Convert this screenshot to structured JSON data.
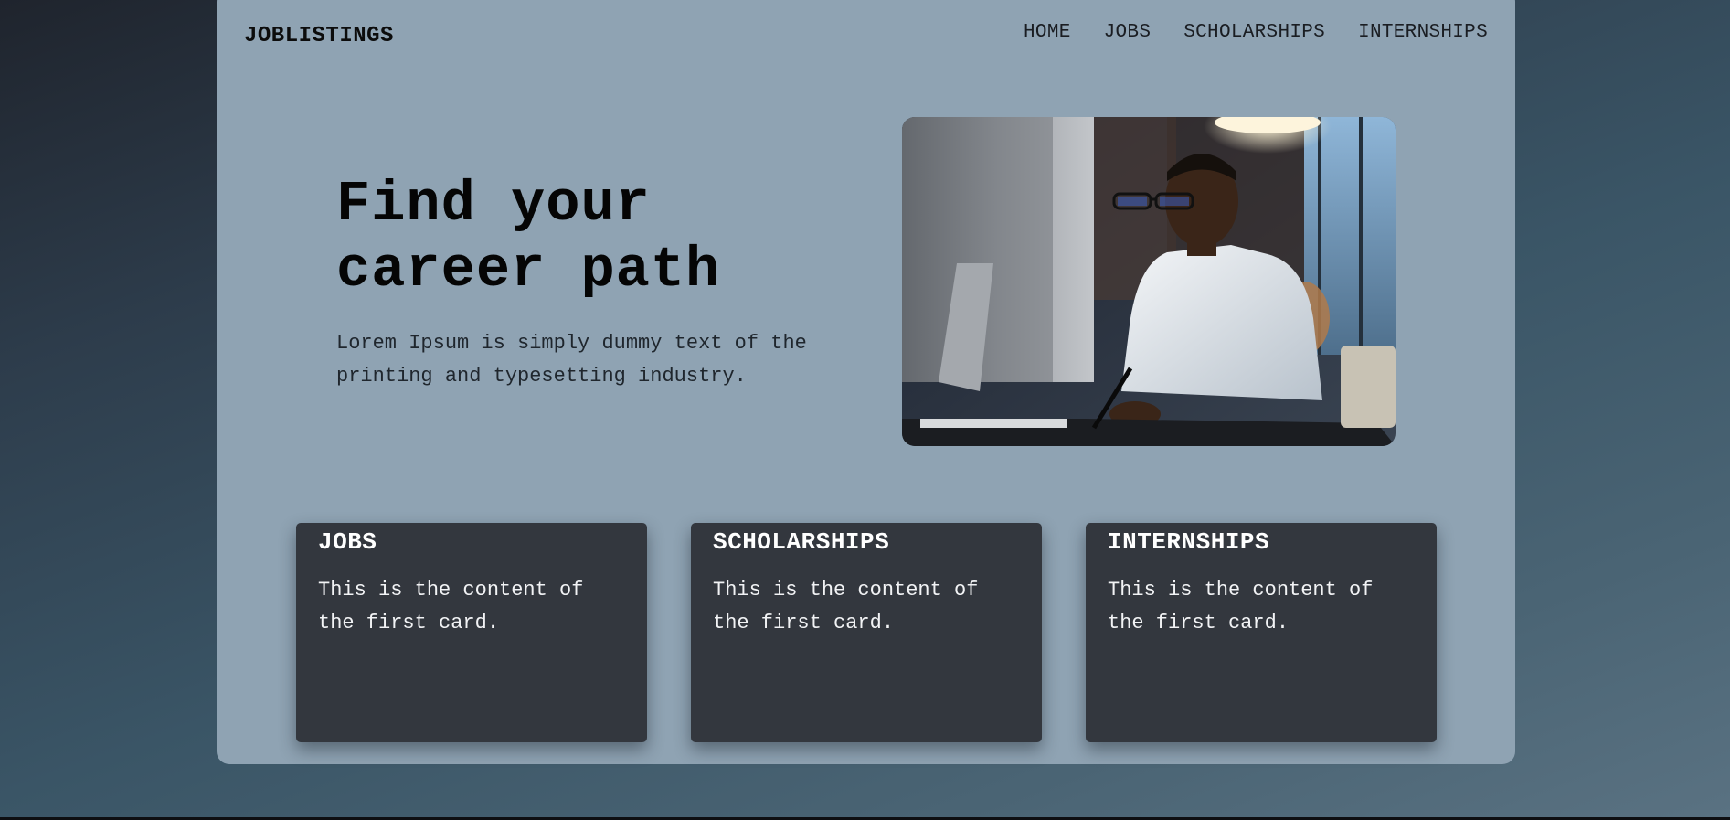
{
  "brand": "JOBLISTINGS",
  "nav": {
    "items": [
      "HOME",
      "JOBS",
      "SCHOLARSHIPS",
      "INTERNSHIPS"
    ]
  },
  "hero": {
    "title": "Find your career path",
    "text": "Lorem Ipsum is simply dummy text of the printing and typesetting industry.",
    "image_icon": "person-at-computer-photo"
  },
  "cards": [
    {
      "title": "JOBS",
      "text": "This is the content of the first card."
    },
    {
      "title": "SCHOLARSHIPS",
      "text": "This is the content of the first card."
    },
    {
      "title": "INTERNSHIPS",
      "text": "This is the content of the first card."
    }
  ],
  "colors": {
    "panel": "#8fa3b3",
    "card": "#33373e",
    "background_dark": "#1f242d",
    "background_light": "#5a7282"
  }
}
